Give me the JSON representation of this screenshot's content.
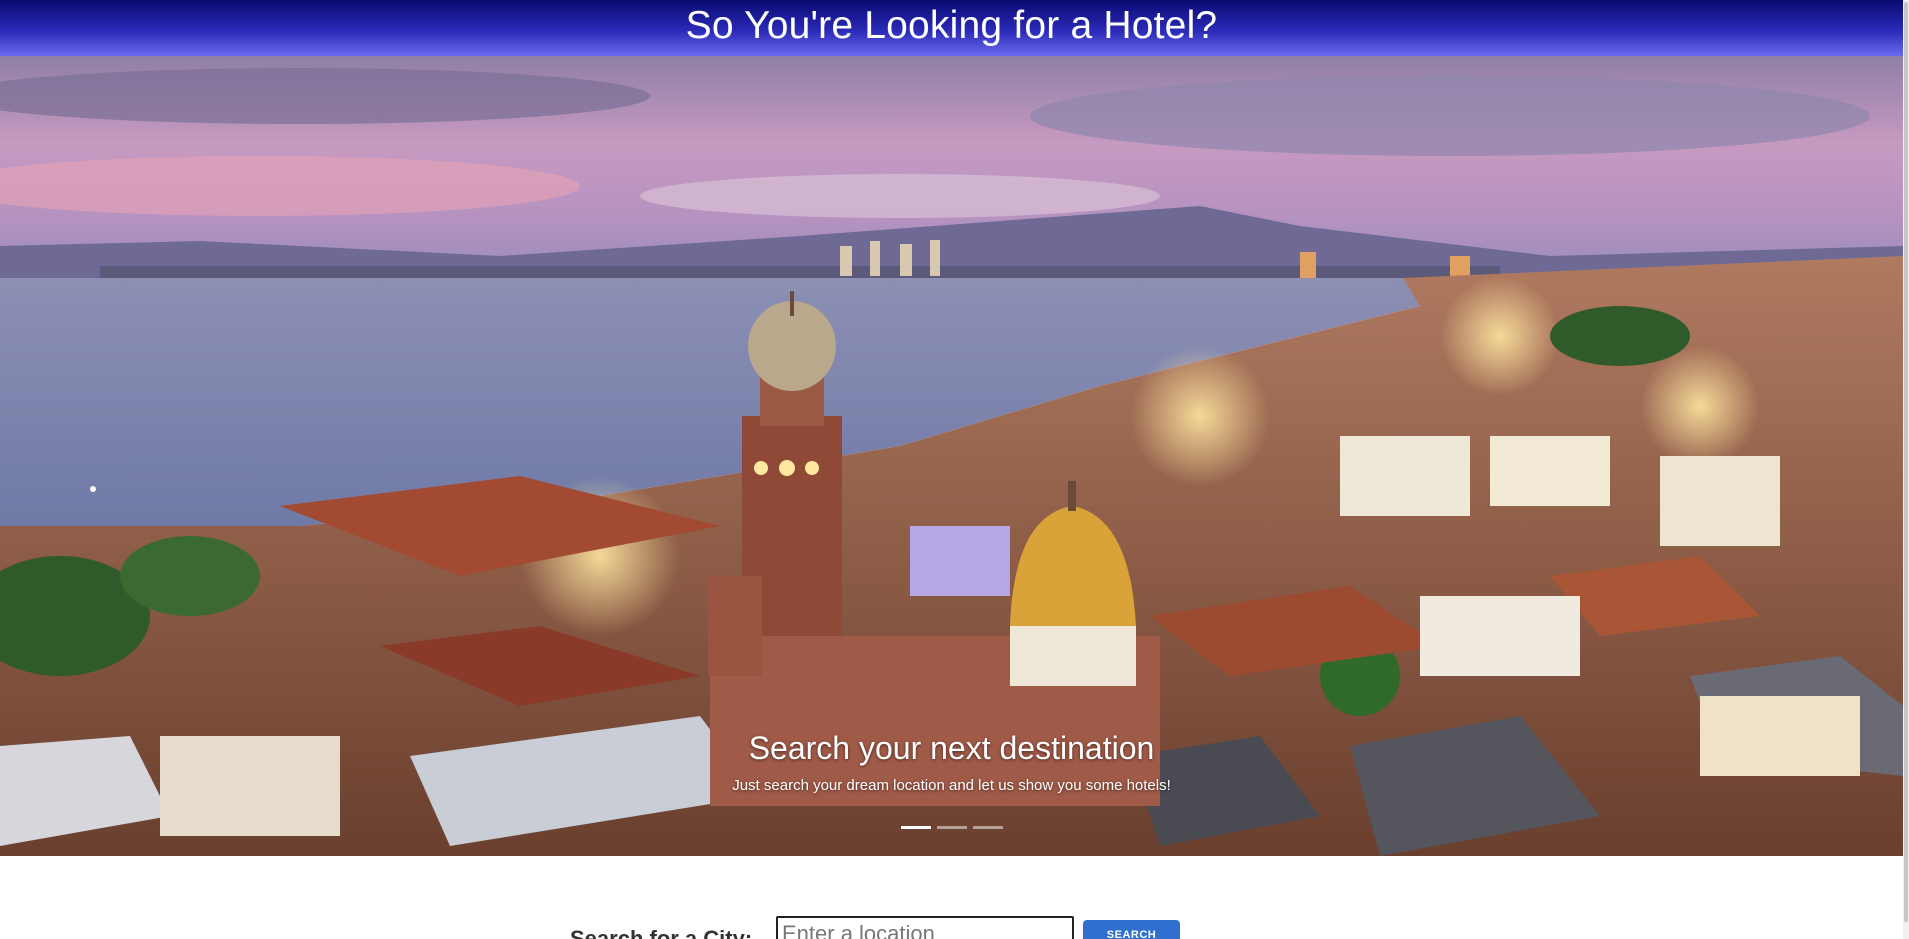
{
  "header": {
    "title": "So You're Looking for a Hotel?"
  },
  "carousel": {
    "image_description_icon": "landscape-photo",
    "caption_title": "Search your next destination",
    "caption_text": "Just search your dream location and let us show you some hotels!",
    "slides_count": 3,
    "active_slide_index": 0
  },
  "search": {
    "label": "Search for a City:",
    "placeholder": "Enter a location",
    "value": "",
    "button_label": "SEARCH"
  },
  "colors": {
    "header_top": "#0a0a72",
    "header_bottom": "#6a6aee",
    "button": "#2f6fd0"
  }
}
